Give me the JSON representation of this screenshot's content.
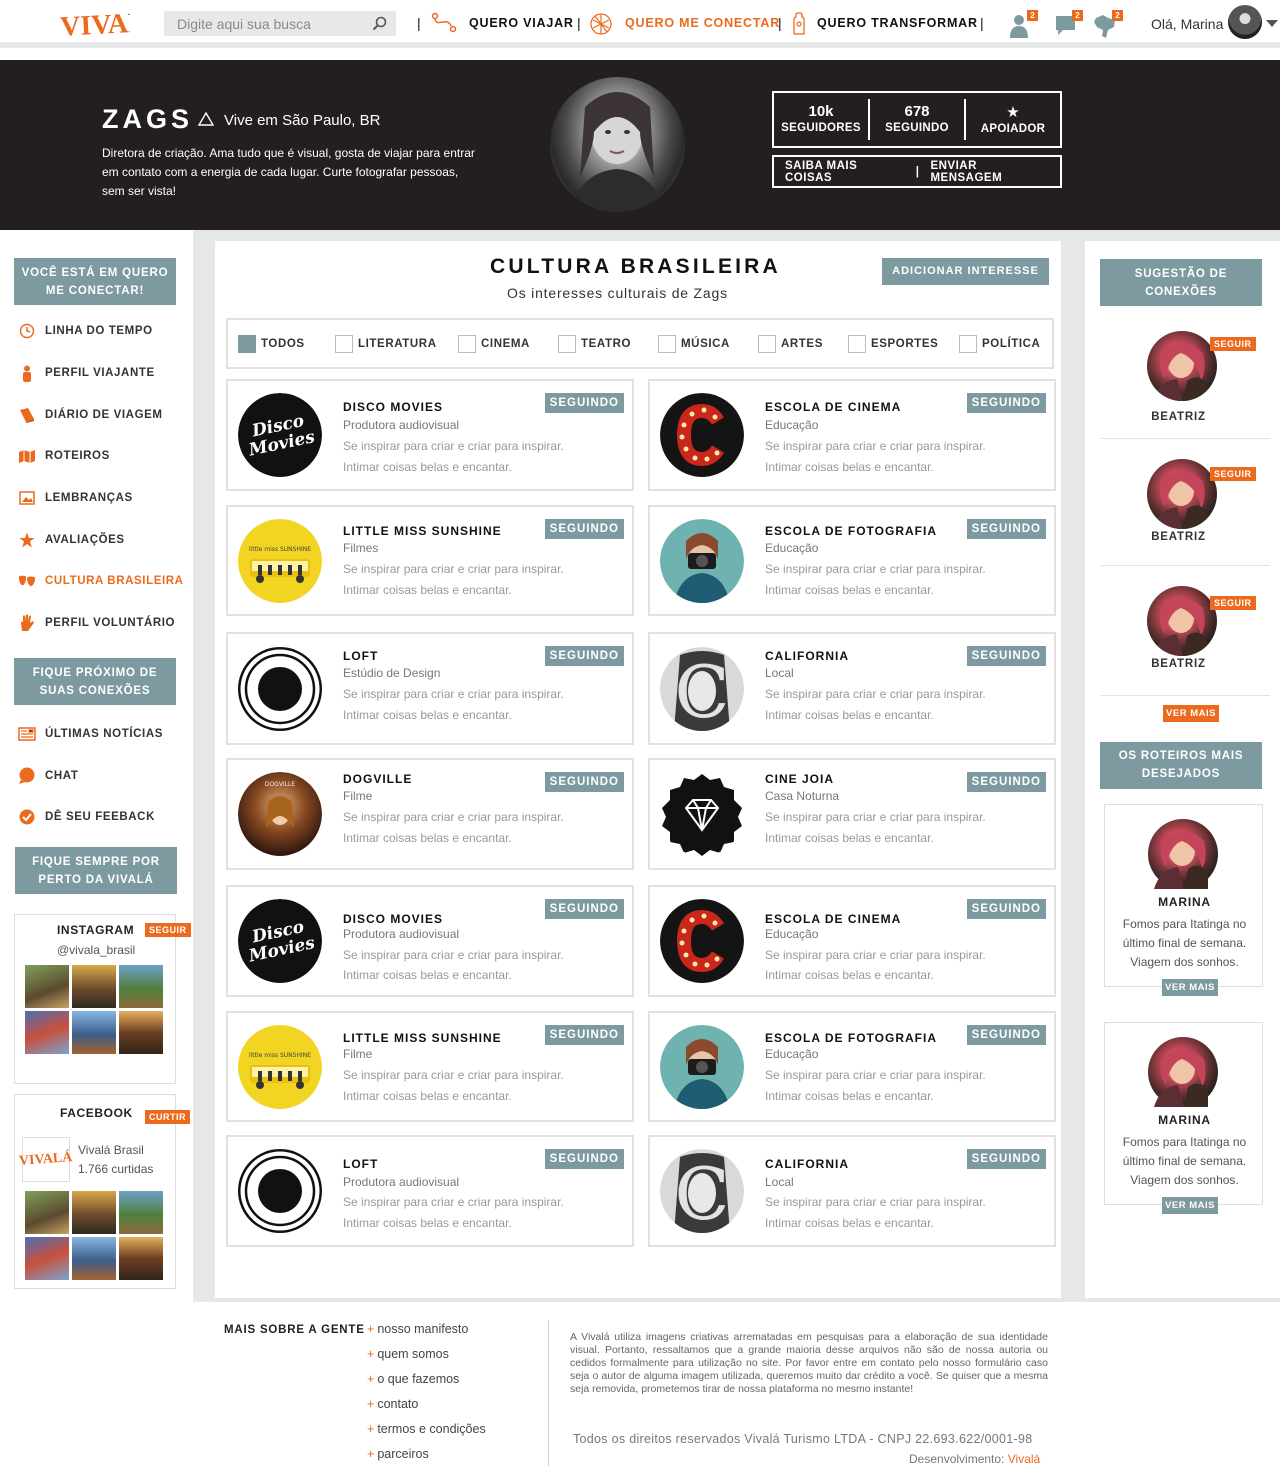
{
  "brand": {
    "logo": "VIVALÁ",
    "accent": "#ec6a1e",
    "grey": "#7d9aa1"
  },
  "search": {
    "placeholder": "Digite aqui sua busca"
  },
  "nav": [
    {
      "label": "QUERO VIAJAR",
      "icon": "route-icon"
    },
    {
      "label": "QUERO ME CONECTAR",
      "icon": "network-icon",
      "active": true
    },
    {
      "label": "QUERO TRANSFORMAR",
      "icon": "hand-icon"
    }
  ],
  "notifications": [
    {
      "icon": "user-icon",
      "count": "2"
    },
    {
      "icon": "chat-icon",
      "count": "2"
    },
    {
      "icon": "map-icon",
      "count": "2"
    }
  ],
  "user": {
    "greeting": "Olá, Marina"
  },
  "profile": {
    "name": "ZAGS",
    "location": "Vive em São Paulo, BR",
    "bio": "Diretora de criação. Ama tudo que é visual, gosta de viajar para entrar em contato com a energia de cada lugar. Curte fotografar pessoas, sem ser vista!",
    "stats": [
      {
        "value": "10k",
        "label": "SEGUIDORES"
      },
      {
        "value": "678",
        "label": "SEGUINDO"
      },
      {
        "value": "★",
        "label": "APOIADOR"
      }
    ],
    "buttons": [
      "SAIBA MAIS COISAS",
      "ENVIAR MENSAGEM"
    ]
  },
  "sidebar": {
    "section1": "VOCÊ ESTÁ EM QUERO ME CONECTAR!",
    "items": [
      {
        "label": "LINHA DO TEMPO",
        "icon": "clock-icon"
      },
      {
        "label": "PERFIL VIAJANTE",
        "icon": "person-icon"
      },
      {
        "label": "DIÁRIO DE VIAGEM",
        "icon": "book-icon"
      },
      {
        "label": "ROTEIROS",
        "icon": "map-folded-icon"
      },
      {
        "label": "LEMBRANÇAS",
        "icon": "picture-icon"
      },
      {
        "label": "AVALIAÇÕES",
        "icon": "star-icon"
      },
      {
        "label": "CULTURA BRASILEIRA",
        "icon": "masks-icon",
        "active": true
      },
      {
        "label": "PERFIL VOLUNTÁRIO",
        "icon": "hand-icon"
      }
    ],
    "section2": "FIQUE PRÓXIMO DE SUAS CONEXÕES",
    "items2": [
      {
        "label": "ÚLTIMAS NOTÍCIAS",
        "icon": "newspaper-icon"
      },
      {
        "label": "CHAT",
        "icon": "chat-bubble-icon"
      },
      {
        "label": "DÊ SEU FEEBACK",
        "icon": "check-circle-icon"
      }
    ],
    "section3": "FIQUE SEMPRE POR PERTO DA VIVALÁ",
    "instagram": {
      "title": "INSTAGRAM",
      "handle": "@vivala_brasil",
      "button": "SEGUIR"
    },
    "facebook": {
      "title": "FACEBOOK",
      "button": "CURTIR",
      "page": "Vivalá Brasil",
      "likes": "1.766 curtidas",
      "logo": "VIVALÁ"
    }
  },
  "main": {
    "title": "CULTURA BRASILEIRA",
    "subtitle": "Os interesses culturais de Zags",
    "add_button": "ADICIONAR INTERESSE",
    "filters": [
      {
        "label": "TODOS",
        "checked": true
      },
      {
        "label": "LITERATURA",
        "checked": false
      },
      {
        "label": "CINEMA",
        "checked": false
      },
      {
        "label": "TEATRO",
        "checked": false
      },
      {
        "label": "MÚSICA",
        "checked": false
      },
      {
        "label": "ARTES",
        "checked": false
      },
      {
        "label": "ESPORTES",
        "checked": false
      },
      {
        "label": "POLÍTICA",
        "checked": false
      }
    ],
    "cards": [
      {
        "name": "DISCO MOVIES",
        "category": "Produtora audiovisual",
        "line1": "Se inspirar para criar e criar para inspirar.",
        "line2": "Intimar coisas belas e encantar.",
        "button": "SEGUINDO",
        "art": "disco"
      },
      {
        "name": "ESCOLA DE CINEMA",
        "category": "Educação",
        "line1": "Se inspirar para criar e criar para inspirar.",
        "line2": "Intimar coisas belas e encantar.",
        "button": "SEGUINDO",
        "art": "cine"
      },
      {
        "name": "LITTLE MISS SUNSHINE",
        "category": "Filmes",
        "line1": "Se inspirar para criar e criar para inspirar.",
        "line2": "Intimar coisas belas e encantar.",
        "button": "SEGUINDO",
        "art": "sun"
      },
      {
        "name": "ESCOLA DE FOTOGRAFIA",
        "category": "Educação",
        "line1": "Se inspirar para criar e criar para inspirar.",
        "line2": "Intimar coisas belas e encantar.",
        "button": "SEGUINDO",
        "art": "foto"
      },
      {
        "name": "LOFT",
        "category": "Estúdio de Design",
        "line1": "Se inspirar para criar e criar para inspirar.",
        "line2": "Intimar coisas belas e encantar.",
        "button": "SEGUINDO",
        "art": "loft"
      },
      {
        "name": "CALIFORNIA",
        "category": "Local",
        "line1": "Se inspirar para criar e criar para inspirar.",
        "line2": "Intimar coisas belas e encantar.",
        "button": "SEGUINDO",
        "art": "cali"
      },
      {
        "name": "DOGVILLE",
        "category": "Filme",
        "line1": "Se inspirar para criar e criar para inspirar.",
        "line2": "Intimar coisas belas e encantar.",
        "button": "SEGUINDO",
        "art": "dog"
      },
      {
        "name": "CINE JOIA",
        "category": "Casa Noturna",
        "line1": "Se inspirar para criar e criar para inspirar.",
        "line2": "Intimar coisas belas e encantar.",
        "button": "SEGUINDO",
        "art": "joia"
      },
      {
        "name": "DISCO MOVIES",
        "category": "Produtora audiovisual",
        "line1": "Se inspirar para criar e criar para inspirar.",
        "line2": "Intimar coisas belas e encantar.",
        "button": "SEGUINDO",
        "art": "disco"
      },
      {
        "name": "ESCOLA DE CINEMA",
        "category": "Educação",
        "line1": "Se inspirar para criar e criar para inspirar.",
        "line2": "Intimar coisas belas e encantar.",
        "button": "SEGUINDO",
        "art": "cine"
      },
      {
        "name": "LITTLE MISS SUNSHINE",
        "category": "Filme",
        "line1": "Se inspirar para criar e criar para inspirar.",
        "line2": "Intimar coisas belas e encantar.",
        "button": "SEGUINDO",
        "art": "sun"
      },
      {
        "name": "ESCOLA DE FOTOGRAFIA",
        "category": "Educação",
        "line1": "Se inspirar para criar e criar para inspirar.",
        "line2": "Intimar coisas belas e encantar.",
        "button": "SEGUINDO",
        "art": "foto"
      },
      {
        "name": "LOFT",
        "category": "Produtora audiovisual",
        "line1": "Se inspirar para criar e criar para inspirar.",
        "line2": "Intimar coisas belas e encantar.",
        "button": "SEGUINDO",
        "art": "loft"
      },
      {
        "name": "CALIFORNIA",
        "category": "Local",
        "line1": "Se inspirar para criar e criar para inspirar.",
        "line2": "Intimar coisas belas e encantar.",
        "button": "SEGUINDO",
        "art": "cali"
      }
    ]
  },
  "right": {
    "suggest_title": "SUGESTÃO DE CONEXÕES",
    "suggestions": [
      {
        "name": "BEATRIZ",
        "button": "SEGUIR"
      },
      {
        "name": "BEATRIZ",
        "button": "SEGUIR"
      },
      {
        "name": "BEATRIZ",
        "button": "SEGUIR"
      }
    ],
    "see_more": "VER MAIS",
    "routes_title": "OS ROTEIROS MAIS DESEJADOS",
    "routes": [
      {
        "name": "MARINA",
        "text": "Fomos para Itatinga no último final de semana. Viagem dos sonhos.",
        "button": "VER MAIS"
      },
      {
        "name": "MARINA",
        "text": "Fomos para Itatinga no último final de semana. Viagem dos sonhos.",
        "button": "VER MAIS"
      }
    ]
  },
  "footer": {
    "title": "MAIS SOBRE A GENTE",
    "links": [
      "nosso manifesto",
      "quem somos",
      "o que fazemos",
      "contato",
      "termos e condições",
      "parceiros"
    ],
    "note": "A Vivalá utiliza imagens criativas arrematadas em pesquisas para a elaboração de sua identidade visual. Portanto, ressaltamos que a grande maioria desse arquivos não são de nossa autoria ou cedidos formalmente para utilização no site. Por favor entre em contato pelo nosso formulário caso seja o autor de alguma imagem utilizada, queremos muito dar crédito a você. Se quiser que a mesma seja removida, prometemos tirar de nossa plataforma no mesmo instante!",
    "copyright": "Todos os direitos reservados Vivalá Turismo LTDA   -  CNPJ 22.693.622/0001-98",
    "dev_label": "Desenvolvimento:",
    "dev_name": "Vivalá"
  }
}
